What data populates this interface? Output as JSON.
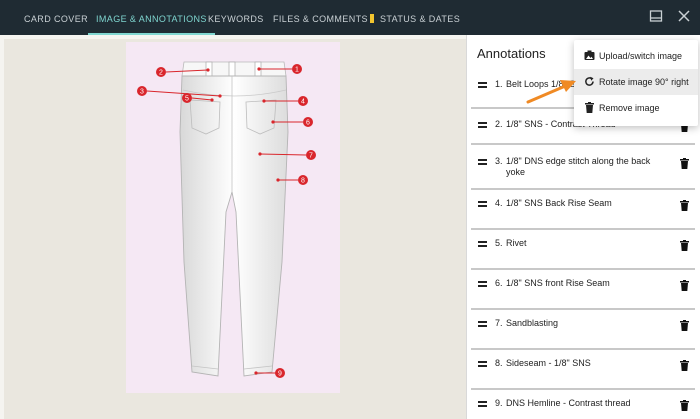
{
  "tabs": [
    {
      "label": "CARD COVER"
    },
    {
      "label": "IMAGE & ANNOTATIONS"
    },
    {
      "label": "KEYWORDS"
    },
    {
      "label": "FILES & COMMENTS"
    },
    {
      "label": "STATUS & DATES"
    }
  ],
  "panel": {
    "title": "Annotations",
    "annotations": [
      {
        "number": "1.",
        "text": "Belt Loops 1/8\" SNS - Contrast Thread"
      },
      {
        "number": "2.",
        "text": "1/8\" SNS - Contrast Thread"
      },
      {
        "number": "3.",
        "text": "1/8\" DNS edge stitch along the back yoke"
      },
      {
        "number": "4.",
        "text": "1/8\" SNS Back Rise Seam"
      },
      {
        "number": "5.",
        "text": "Rivet"
      },
      {
        "number": "6.",
        "text": "1/8\" SNS front Rise Seam"
      },
      {
        "number": "7.",
        "text": "Sandblasting"
      },
      {
        "number": "8.",
        "text": "Sideseam - 1/8\" SNS"
      },
      {
        "number": "9.",
        "text": "DNS Hemline - Contrast thread"
      }
    ]
  },
  "menu": {
    "items": [
      {
        "label": "Upload/switch image",
        "icon": "image-icon"
      },
      {
        "label": "Rotate image 90° right",
        "icon": "rotate-icon"
      },
      {
        "label": "Remove image",
        "icon": "trash-icon"
      }
    ]
  },
  "markers": [
    "1",
    "2",
    "3",
    "4",
    "5",
    "6",
    "7",
    "8",
    "9"
  ],
  "colors": {
    "topbar": "#1f2b33",
    "active_tab": "#7fd6d0",
    "marker": "#d9262c",
    "arrow": "#f08a24"
  }
}
